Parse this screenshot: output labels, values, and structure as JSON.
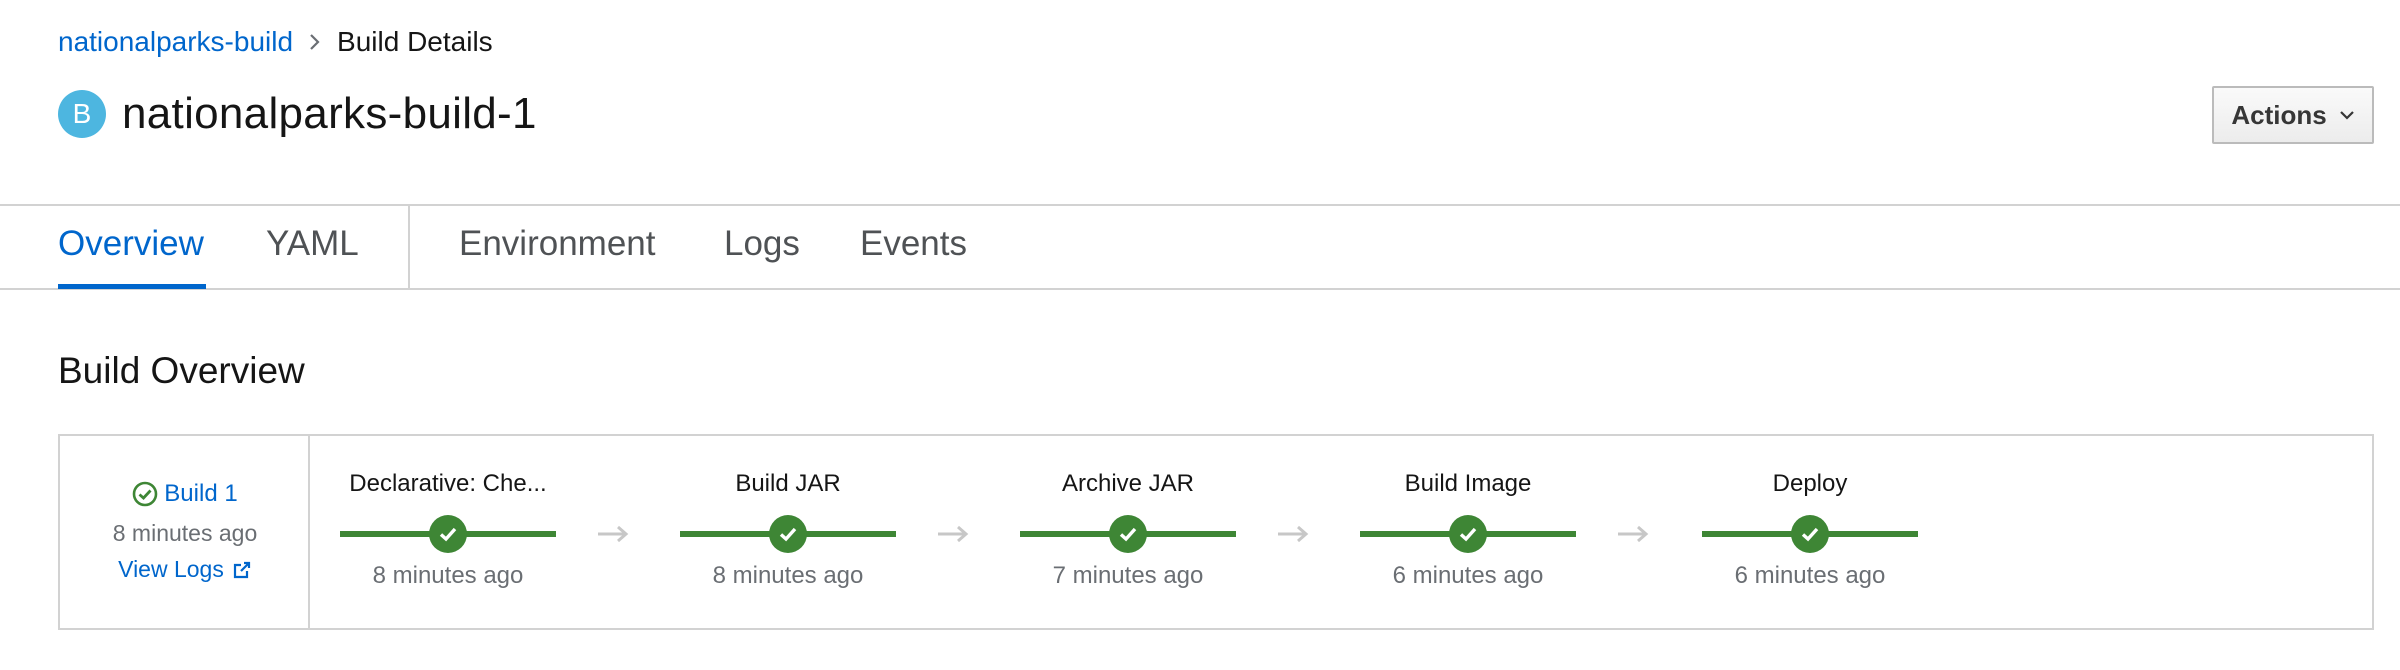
{
  "breadcrumb": {
    "parent": "nationalparks-build",
    "current": "Build Details"
  },
  "header": {
    "badge": "B",
    "title": "nationalparks-build-1",
    "actions_label": "Actions"
  },
  "tabs": [
    {
      "label": "Overview",
      "active": true
    },
    {
      "label": "YAML",
      "active": false
    },
    {
      "label": "Environment",
      "active": false
    },
    {
      "label": "Logs",
      "active": false
    },
    {
      "label": "Events",
      "active": false
    }
  ],
  "section_title": "Build Overview",
  "build": {
    "name": "Build 1",
    "time": "8 minutes ago",
    "view_logs": "View Logs",
    "status": "success"
  },
  "stages": [
    {
      "name": "Declarative: Che...",
      "time": "8 minutes ago",
      "status": "success"
    },
    {
      "name": "Build JAR",
      "time": "8 minutes ago",
      "status": "success"
    },
    {
      "name": "Archive JAR",
      "time": "7 minutes ago",
      "status": "success"
    },
    {
      "name": "Build Image",
      "time": "6 minutes ago",
      "status": "success"
    },
    {
      "name": "Deploy",
      "time": "6 minutes ago",
      "status": "success"
    }
  ],
  "colors": {
    "link": "#0066cc",
    "success": "#3e8635",
    "badge": "#4db6e0",
    "muted": "#6a6e73"
  },
  "icons": {
    "separator": "chevron-right-icon",
    "actions": "chevron-down-icon",
    "status": "check-circle-icon",
    "external": "external-link-icon",
    "connector": "arrow-right-icon"
  }
}
